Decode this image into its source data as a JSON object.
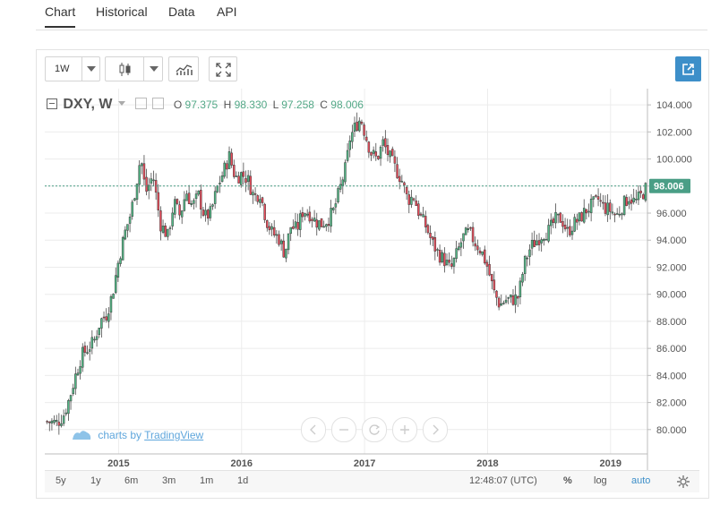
{
  "tabs": [
    {
      "label": "Chart",
      "active": true
    },
    {
      "label": "Historical",
      "active": false
    },
    {
      "label": "Data",
      "active": false
    },
    {
      "label": "API",
      "active": false
    }
  ],
  "toolbar": {
    "interval_label": "1W",
    "chart_type_icon": "candlestick-icon",
    "indicators_icon": "indicators-icon",
    "fullscreen_icon": "fullscreen-icon",
    "popout_icon": "popout-icon"
  },
  "legend": {
    "symbol": "DXY, W",
    "open_label": "O",
    "open_value": "97.375",
    "high_label": "H",
    "high_value": "98.330",
    "low_label": "L",
    "low_value": "97.258",
    "close_label": "C",
    "close_value": "98.006"
  },
  "watermark": {
    "prefix": "charts by",
    "brand": "TradingView"
  },
  "bottom_bar": {
    "ranges": [
      "5y",
      "1y",
      "6m",
      "3m",
      "1m",
      "1d"
    ],
    "clock": "12:48:07 (UTC)",
    "percent_label": "%",
    "log_label": "log",
    "auto_label": "auto"
  },
  "colors": {
    "up": "#53b987",
    "down": "#eb4d5c",
    "price_line": "#4a9e86",
    "price_badge": "#4a9e86",
    "auto": "#3d8fc9"
  },
  "chart_data": {
    "type": "candlestick",
    "interval": "weekly",
    "x_ticks": [
      "2015",
      "2016",
      "2017",
      "2018",
      "2019"
    ],
    "x_tick_positions_years": [
      2015,
      2016,
      2017,
      2018,
      2019
    ],
    "x_range_years": [
      2014.4,
      2019.3
    ],
    "y_ticks": [
      "80.000",
      "82.000",
      "84.000",
      "86.000",
      "88.000",
      "90.000",
      "92.000",
      "94.000",
      "96.000",
      "98.000",
      "100.000",
      "102.000",
      "104.000"
    ],
    "ylim": [
      78.2,
      105.2
    ],
    "last_price": 98.006,
    "last_price_label": "98.006",
    "grid": true,
    "close_path": [
      [
        2014.4,
        80.6
      ],
      [
        2014.5,
        80.5
      ],
      [
        2014.55,
        81.0
      ],
      [
        2014.6,
        82.3
      ],
      [
        2014.65,
        84.0
      ],
      [
        2014.7,
        85.5
      ],
      [
        2014.8,
        86.5
      ],
      [
        2014.85,
        88.0
      ],
      [
        2014.9,
        88.5
      ],
      [
        2014.95,
        90.0
      ],
      [
        2015.0,
        92.5
      ],
      [
        2015.05,
        94.5
      ],
      [
        2015.1,
        96.0
      ],
      [
        2015.15,
        98.5
      ],
      [
        2015.18,
        100.2
      ],
      [
        2015.22,
        97.5
      ],
      [
        2015.28,
        98.8
      ],
      [
        2015.34,
        95.2
      ],
      [
        2015.4,
        94.3
      ],
      [
        2015.45,
        96.8
      ],
      [
        2015.5,
        95.8
      ],
      [
        2015.55,
        97.6
      ],
      [
        2015.6,
        96.5
      ],
      [
        2015.65,
        97.3
      ],
      [
        2015.7,
        95.7
      ],
      [
        2015.75,
        96.0
      ],
      [
        2015.8,
        97.8
      ],
      [
        2015.85,
        99.0
      ],
      [
        2015.9,
        100.2
      ],
      [
        2015.95,
        98.6
      ],
      [
        2016.0,
        98.9
      ],
      [
        2016.05,
        98.5
      ],
      [
        2016.1,
        97.2
      ],
      [
        2016.15,
        97.5
      ],
      [
        2016.2,
        95.5
      ],
      [
        2016.25,
        94.5
      ],
      [
        2016.3,
        94.2
      ],
      [
        2016.35,
        93.0
      ],
      [
        2016.4,
        95.0
      ],
      [
        2016.45,
        94.8
      ],
      [
        2016.5,
        96.2
      ],
      [
        2016.55,
        96.0
      ],
      [
        2016.6,
        95.4
      ],
      [
        2016.65,
        95.2
      ],
      [
        2016.7,
        95.5
      ],
      [
        2016.75,
        96.2
      ],
      [
        2016.8,
        97.8
      ],
      [
        2016.85,
        99.5
      ],
      [
        2016.88,
        101.5
      ],
      [
        2016.93,
        102.5
      ],
      [
        2016.97,
        103.0
      ],
      [
        2017.0,
        102.0
      ],
      [
        2017.05,
        100.5
      ],
      [
        2017.1,
        100.0
      ],
      [
        2017.15,
        101.2
      ],
      [
        2017.2,
        100.2
      ],
      [
        2017.25,
        99.3
      ],
      [
        2017.3,
        98.5
      ],
      [
        2017.35,
        97.0
      ],
      [
        2017.4,
        97.2
      ],
      [
        2017.45,
        95.8
      ],
      [
        2017.5,
        95.0
      ],
      [
        2017.55,
        93.8
      ],
      [
        2017.6,
        93.0
      ],
      [
        2017.65,
        92.5
      ],
      [
        2017.7,
        91.8
      ],
      [
        2017.75,
        93.0
      ],
      [
        2017.8,
        94.2
      ],
      [
        2017.85,
        94.6
      ],
      [
        2017.9,
        93.8
      ],
      [
        2017.95,
        93.2
      ],
      [
        2018.0,
        92.0
      ],
      [
        2018.05,
        90.2
      ],
      [
        2018.1,
        89.2
      ],
      [
        2018.15,
        89.6
      ],
      [
        2018.2,
        89.6
      ],
      [
        2018.25,
        89.8
      ],
      [
        2018.3,
        92.3
      ],
      [
        2018.35,
        93.5
      ],
      [
        2018.4,
        94.0
      ],
      [
        2018.45,
        94.5
      ],
      [
        2018.5,
        94.7
      ],
      [
        2018.55,
        95.5
      ],
      [
        2018.6,
        95.6
      ],
      [
        2018.65,
        94.6
      ],
      [
        2018.7,
        95.2
      ],
      [
        2018.75,
        95.6
      ],
      [
        2018.8,
        96.2
      ],
      [
        2018.85,
        96.6
      ],
      [
        2018.9,
        97.0
      ],
      [
        2018.95,
        96.4
      ],
      [
        2019.0,
        96.2
      ],
      [
        2019.05,
        95.8
      ],
      [
        2019.1,
        96.6
      ],
      [
        2019.15,
        97.2
      ],
      [
        2019.2,
        96.8
      ],
      [
        2019.25,
        97.3
      ],
      [
        2019.3,
        98.006
      ]
    ]
  }
}
